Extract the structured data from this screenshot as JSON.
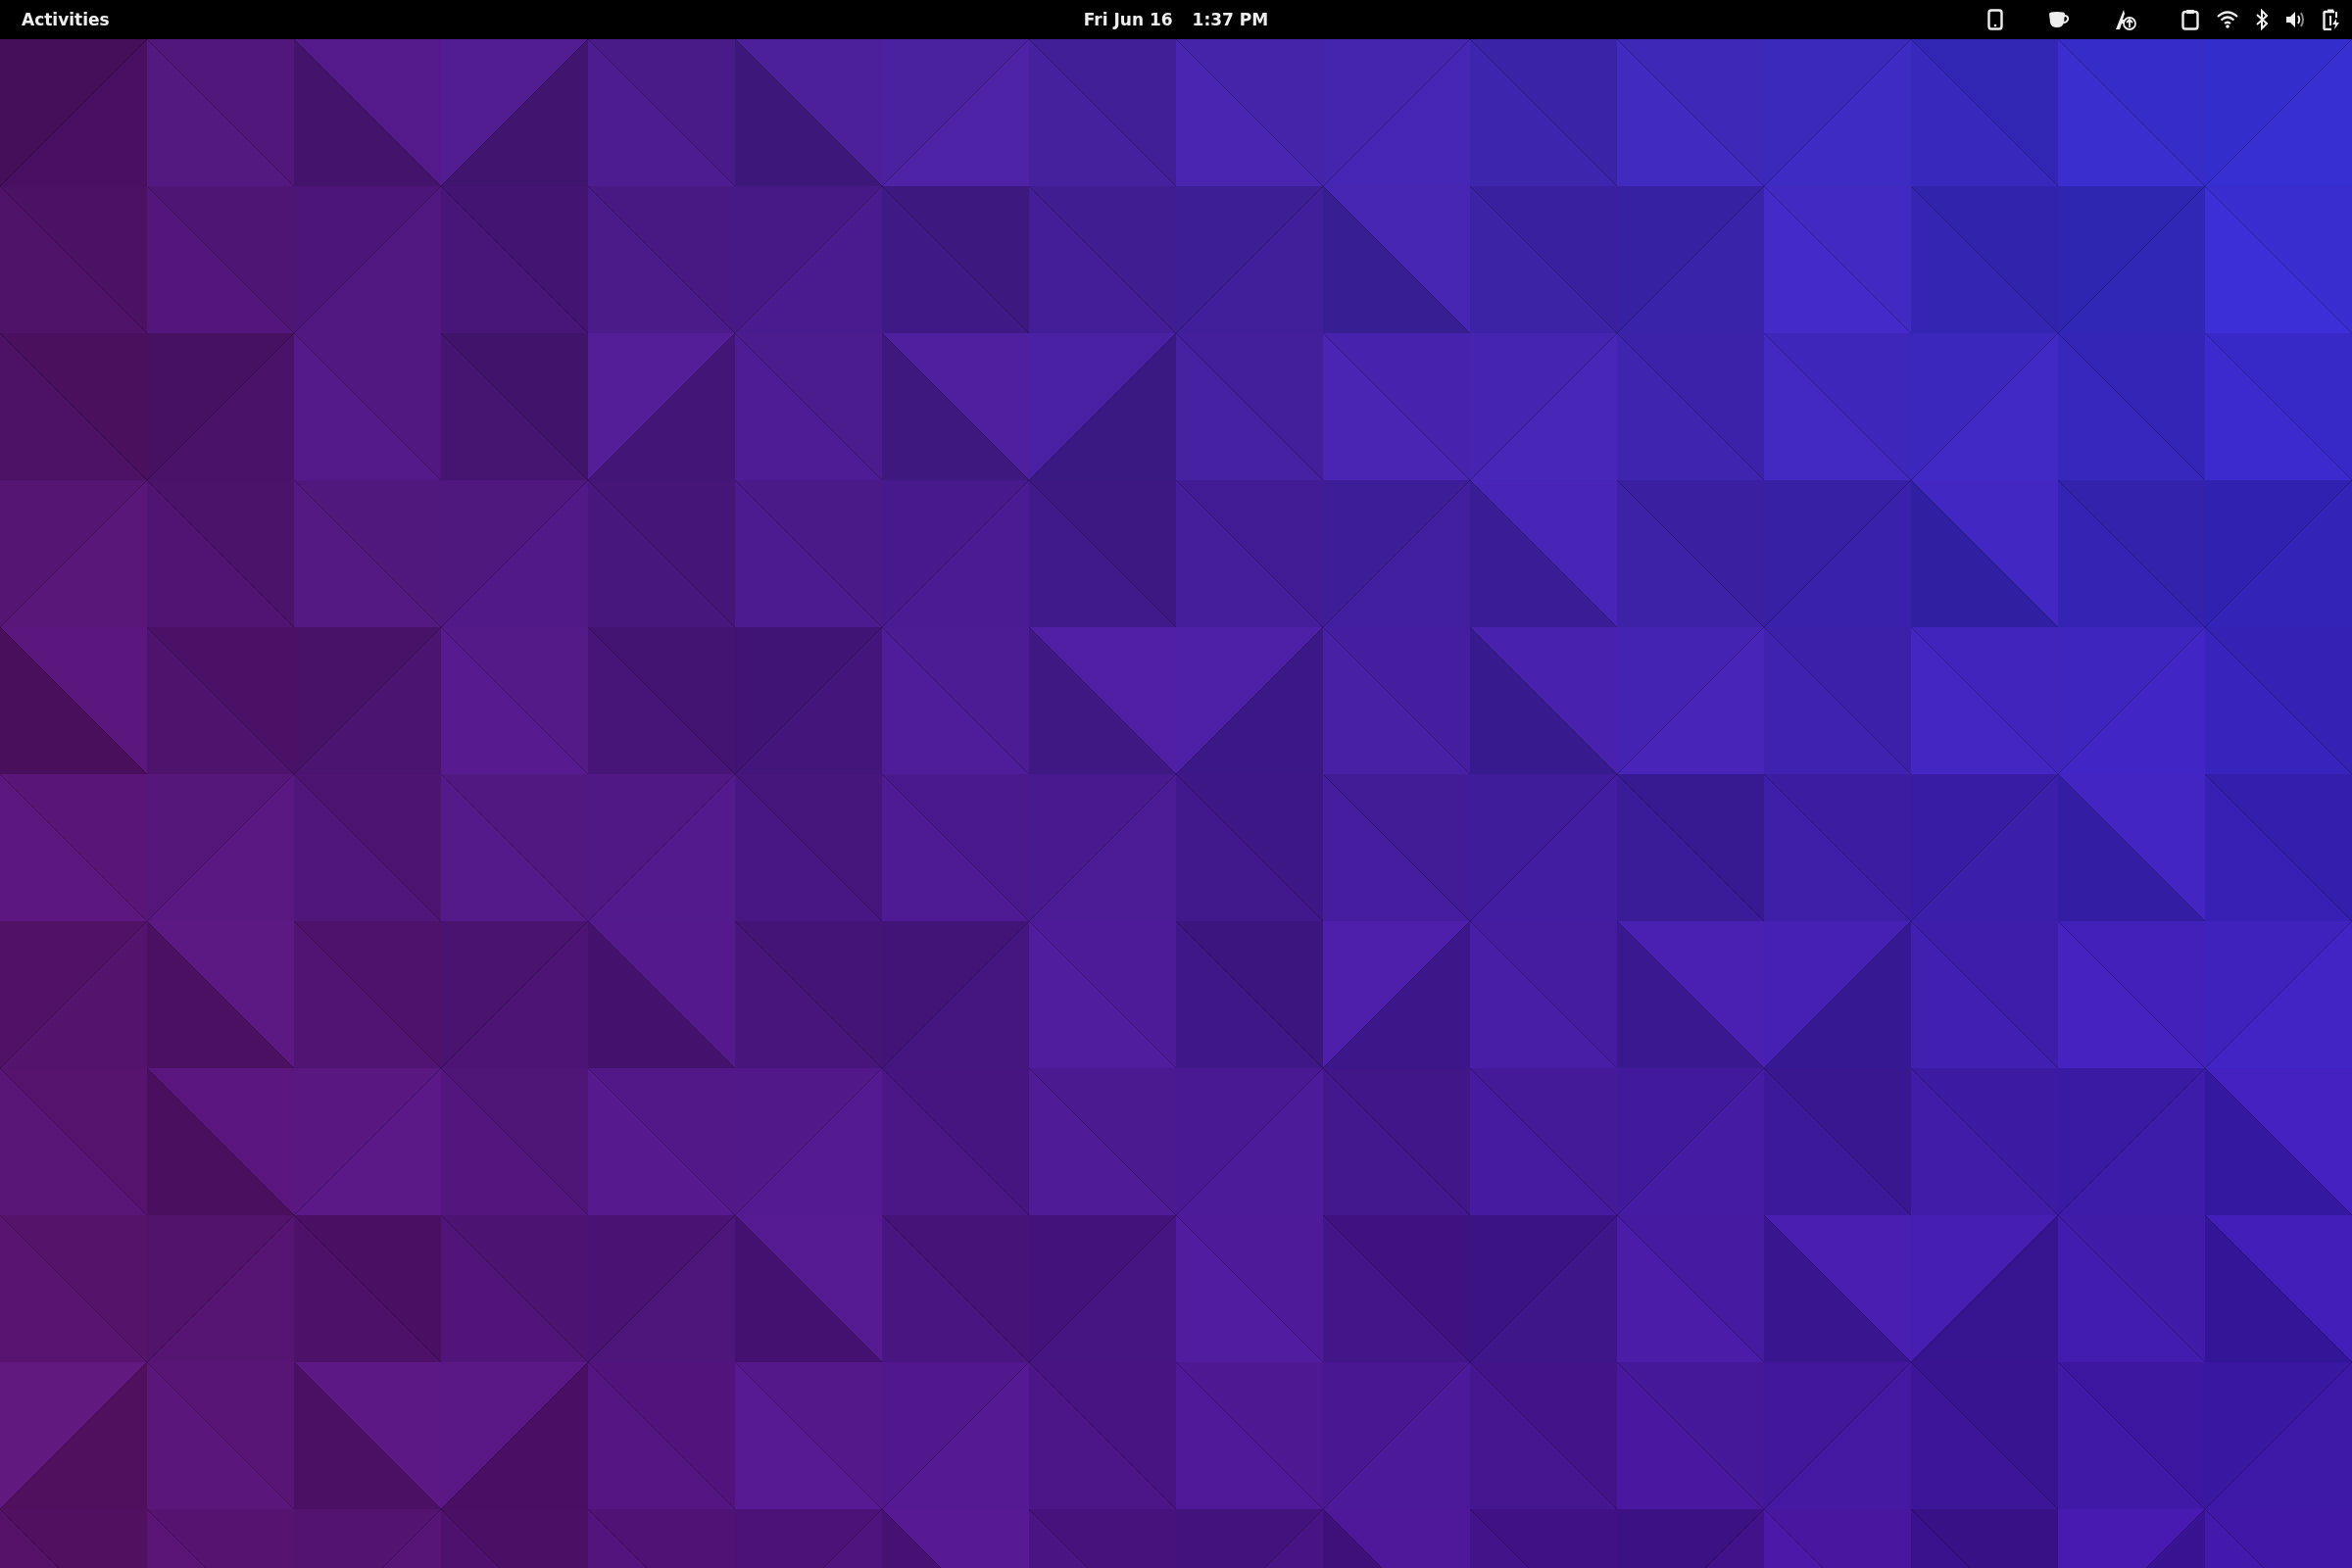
{
  "top_bar": {
    "activities": "Activities",
    "date": "Fri Jun 16",
    "time": "1:37 PM"
  }
}
